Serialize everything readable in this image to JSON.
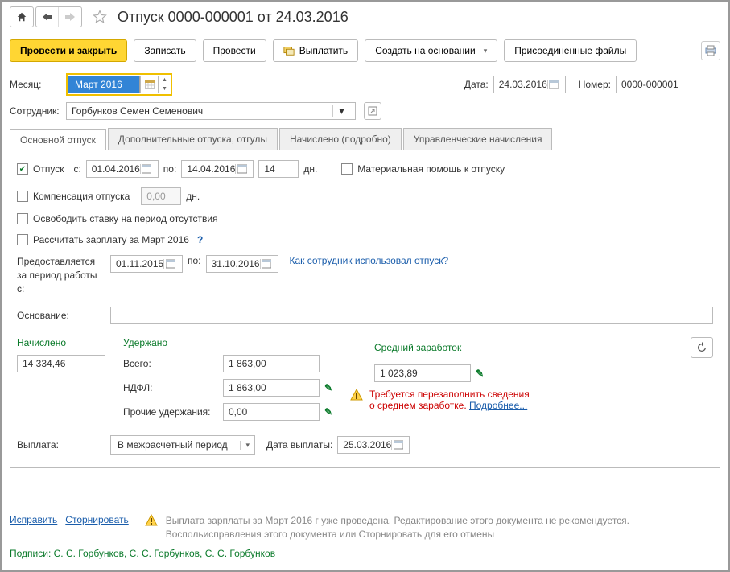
{
  "title": "Отпуск 0000-000001 от 24.03.2016",
  "toolbar": {
    "post_close": "Провести и закрыть",
    "write": "Записать",
    "post": "Провести",
    "pay": "Выплатить",
    "create_basis": "Создать на основании",
    "attached": "Присоединенные файлы"
  },
  "head": {
    "month_lbl": "Месяц:",
    "month_val": "Март 2016",
    "date_lbl": "Дата:",
    "date_val": "24.03.2016",
    "num_lbl": "Номер:",
    "num_val": "0000-000001",
    "emp_lbl": "Сотрудник:",
    "emp_val": "Горбунков Семен Семенович"
  },
  "tabs": {
    "main": "Основной отпуск",
    "extra": "Дополнительные отпуска, отгулы",
    "accrued": "Начислено (подробно)",
    "mgmt": "Управленческие начисления"
  },
  "main": {
    "vac_lbl": "Отпуск",
    "from_lbl": "с:",
    "from_val": "01.04.2016",
    "to_lbl": "по:",
    "to_val": "14.04.2016",
    "days_val": "14",
    "days_unit": "дн.",
    "mathelp_lbl": "Материальная помощь к отпуску",
    "comp_lbl": "Компенсация отпуска",
    "comp_val": "0,00",
    "comp_unit": "дн.",
    "free_lbl": "Освободить ставку на период отсутствия",
    "calc_lbl": "Рассчитать зарплату за Март 2016",
    "help_q": "?",
    "period_lbl": "Предоставляется за период работы с:",
    "period_from": "01.11.2015",
    "period_to_lbl": "по:",
    "period_to": "31.10.2016",
    "period_link": "Как сотрудник использовал отпуск?",
    "basis_lbl": "Основание:"
  },
  "sum": {
    "accrued_h": "Начислено",
    "accrued_val": "14 334,46",
    "ded_h": "Удержано",
    "total_lbl": "Всего:",
    "total_val": "1 863,00",
    "tax_lbl": "НДФЛ:",
    "tax_val": "1 863,00",
    "other_lbl": "Прочие удержания:",
    "other_val": "0,00",
    "avg_h": "Средний заработок",
    "avg_val": "1 023,89",
    "warn1": "Требуется перезаполнить сведения",
    "warn2": "о среднем заработке. ",
    "more": "Подробнее..."
  },
  "pay": {
    "lbl": "Выплата:",
    "mode": "В межрасчетный период",
    "date_lbl": "Дата выплаты:",
    "date_val": "25.03.2016"
  },
  "footer": {
    "fix": "Исправить",
    "rev": "Сторнировать",
    "warn": "Выплата зарплаты за Март 2016 г уже проведена. Редактирование этого документа не рекомендуется. Воспольисправления этого документа или Сторнировать для его отмены",
    "sign_lbl": "Подписи: ",
    "sign": "С. С. Горбунков, С. С. Горбунков, С. С. Горбунков"
  }
}
